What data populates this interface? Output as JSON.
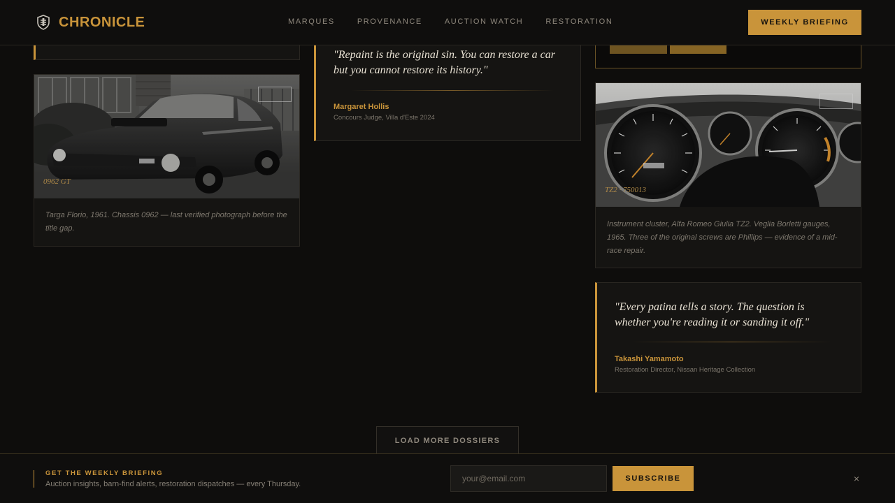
{
  "header": {
    "brand": "CHRONICLE",
    "nav": [
      "MARQUES",
      "PROVENANCE",
      "AUCTION WATCH",
      "RESTORATION"
    ],
    "cta": "WEEKLY BRIEFING"
  },
  "cards": {
    "car_photo": {
      "tag": "0962 GT",
      "caption": "Targa Florio, 1961. Chassis 0962 — last verified photograph before the title gap."
    },
    "quote_1": {
      "text": "\"Repaint is the original sin. You can restore a car but you cannot restore its history.\"",
      "name": "Margaret Hollis",
      "role": "Concours Judge, Villa d'Este 2024"
    },
    "dash_photo": {
      "tag": "TZ2 · 750013",
      "caption": "Instrument cluster, Alfa Romeo Giulia TZ2. Veglia Borletti gauges, 1965. Three of the original screws are Phillips — evidence of a mid-race repair."
    },
    "quote_2": {
      "text": "\"Every patina tells a story. The question is whether you're reading it or sanding it off.\"",
      "name": "Takashi Yamamoto",
      "role": "Restoration Director, Nissan Heritage Collection"
    }
  },
  "load_more": "LOAD MORE DOSSIERS",
  "newsletter": {
    "title": "GET THE WEEKLY BRIEFING",
    "subtitle": "Auction insights, barn-find alerts, restoration dispatches — every Thursday.",
    "email_placeholder": "your@email.com",
    "subscribe": "SUBSCRIBE",
    "close": "×"
  },
  "colors": {
    "accent": "#c9943a",
    "background": "#0e0d0c",
    "card": "#151412"
  }
}
